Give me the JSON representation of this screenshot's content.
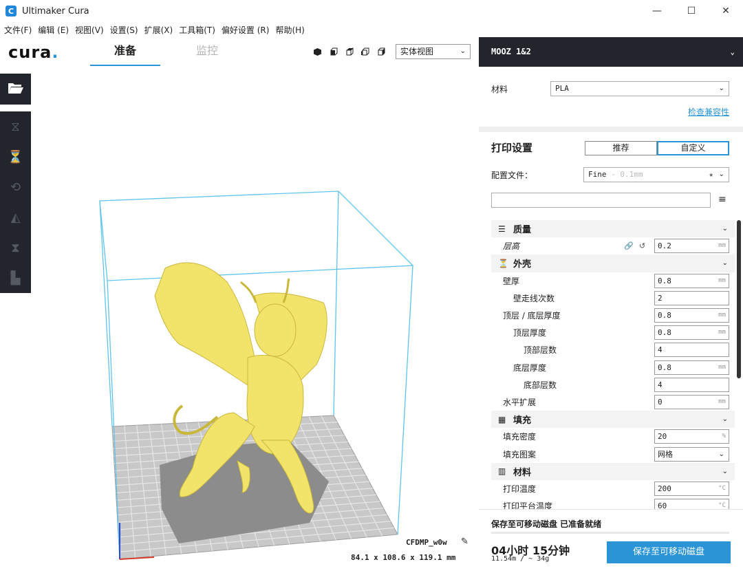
{
  "window": {
    "title": "Ultimaker Cura",
    "icon": "C",
    "minimize": "—",
    "maximize": "☐",
    "close": "✕"
  },
  "menu": [
    "文件(F)",
    "编辑 (E)",
    "视图(V)",
    "设置(S)",
    "扩展(X)",
    "工具箱(T)",
    "偏好设置 (R)",
    "帮助(H)"
  ],
  "header": {
    "logo": "cura",
    "logo_dot": ".",
    "tabs": {
      "prepare": "准备",
      "monitor": "监控"
    },
    "view_mode": "实体视图"
  },
  "viewport": {
    "model_name": "CFDMP_w0w",
    "dimensions": "84.1 x 108.6 x 119.1 mm"
  },
  "panel": {
    "machine": "MOOZ 1&2",
    "material_label": "材料",
    "material_value": "PLA",
    "compat_link": "检查兼容性",
    "print_settings_title": "打印设置",
    "mode_recommended": "推荐",
    "mode_custom": "自定义",
    "profile_label": "配置文件：",
    "profile_value": "Fine",
    "profile_hint": "- 0.1mm",
    "search_placeholder": ""
  },
  "settings": [
    {
      "type": "cat",
      "icon": "quality-icon",
      "glyph": "☰",
      "label": "质量"
    },
    {
      "type": "row",
      "label": "层高",
      "indent": 0,
      "value": "0.2",
      "unit": "mm",
      "italic": true,
      "linked": true
    },
    {
      "type": "cat",
      "icon": "shell-icon",
      "glyph": "⏳",
      "label": "外壳"
    },
    {
      "type": "row",
      "label": "壁厚",
      "indent": 0,
      "value": "0.8",
      "unit": "mm"
    },
    {
      "type": "row",
      "label": "壁走线次数",
      "indent": 1,
      "value": "2",
      "unit": ""
    },
    {
      "type": "row",
      "label": "顶层 / 底层厚度",
      "indent": 0,
      "value": "0.8",
      "unit": "mm"
    },
    {
      "type": "row",
      "label": "顶层厚度",
      "indent": 1,
      "value": "0.8",
      "unit": "mm"
    },
    {
      "type": "row",
      "label": "顶部层数",
      "indent": 2,
      "value": "4",
      "unit": ""
    },
    {
      "type": "row",
      "label": "底层厚度",
      "indent": 1,
      "value": "0.8",
      "unit": "mm"
    },
    {
      "type": "row",
      "label": "底部层数",
      "indent": 2,
      "value": "4",
      "unit": ""
    },
    {
      "type": "row",
      "label": "水平扩展",
      "indent": 0,
      "value": "0",
      "unit": "mm"
    },
    {
      "type": "cat",
      "icon": "infill-icon",
      "glyph": "▦",
      "label": "填充"
    },
    {
      "type": "row",
      "label": "填充密度",
      "indent": 0,
      "value": "20",
      "unit": "%"
    },
    {
      "type": "row",
      "label": "填充图案",
      "indent": 0,
      "value": "网格",
      "unit": "",
      "select": true
    },
    {
      "type": "cat",
      "icon": "material-icon",
      "glyph": "▥",
      "label": "材料"
    },
    {
      "type": "row",
      "label": "打印温度",
      "indent": 0,
      "value": "200",
      "unit": "°C"
    },
    {
      "type": "row",
      "label": "打印平台温度",
      "indent": 0,
      "value": "60",
      "unit": "°C"
    }
  ],
  "bottom": {
    "status": "保存至可移动磁盘 已准备就绪",
    "time": "04小时 15分钟",
    "usage": "11.54m / ~ 34g",
    "save_button": "保存至可移动磁盘"
  },
  "colors": {
    "accent": "#2a94d6",
    "dark": "#22252b",
    "model": "#f2e36a",
    "bbox": "#5ec4ec"
  }
}
